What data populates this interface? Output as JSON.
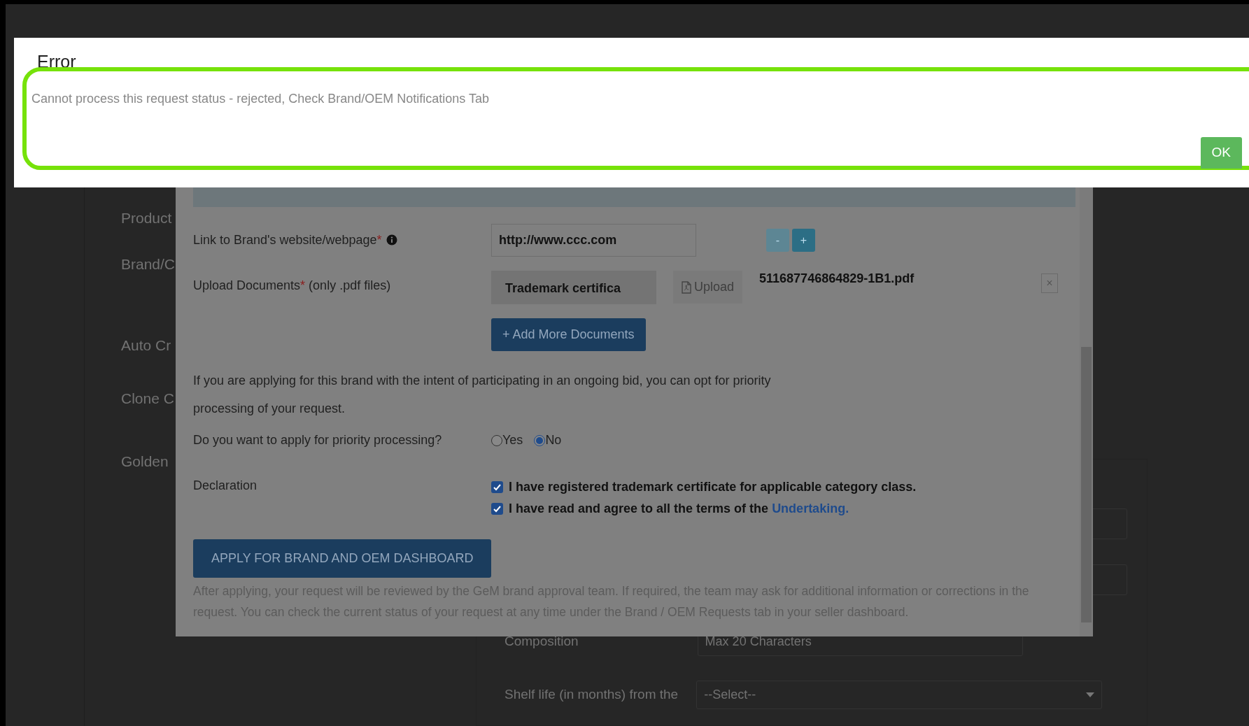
{
  "background_page": {
    "labels": [
      "Product",
      "Brand/C",
      "Auto Cr",
      "Clone C",
      "Golden"
    ],
    "composition_label": "Composition",
    "composition_placeholder": "Max 20 Characters",
    "shelf_life_label": "Shelf life (in months) from the",
    "shelf_life_select": "--Select--"
  },
  "modal": {
    "website": {
      "label": "Link to Brand's website/webpage",
      "required_mark": "*",
      "value": "http://www.ccc.com",
      "remove_button": "-",
      "remove_disabled": true,
      "add_button": "+"
    },
    "upload": {
      "label": "Upload Documents",
      "required_mark": "*",
      "hint": "(only .pdf files)",
      "document_type": "Trademark certifica",
      "upload_button": "Upload",
      "file_name": "511687746864829-1B1.pdf",
      "remove_file": "×"
    },
    "add_documents_button": "+ Add More Documents",
    "priority_note": "If you are applying for this brand with the intent of participating in an ongoing bid, you can opt for priority processing of your request.",
    "priority": {
      "question": "Do you want to apply for priority processing?",
      "options": [
        {
          "label": "Yes",
          "selected": false
        },
        {
          "label": "No",
          "selected": true
        }
      ]
    },
    "declaration": {
      "label": "Declaration",
      "items": [
        {
          "text": "I have registered trademark certificate for applicable category class.",
          "checked": true
        },
        {
          "text": "I have read and agree to all the terms of the",
          "link": "Undertaking.",
          "checked": true
        }
      ]
    },
    "apply_button": "APPLY FOR BRAND AND OEM DASHBOARD",
    "after_note": "After applying, your request will be reviewed by the GeM brand approval team. If required, the team may ask for additional information or corrections in the request. You can check the current status of your request at any time under the Brand / OEM Requests tab in your seller dashboard."
  },
  "error_dialog": {
    "title": "Error",
    "message": "Cannot process this request status - rejected, Check Brand/OEM Notifications Tab",
    "ok_button": "OK"
  }
}
